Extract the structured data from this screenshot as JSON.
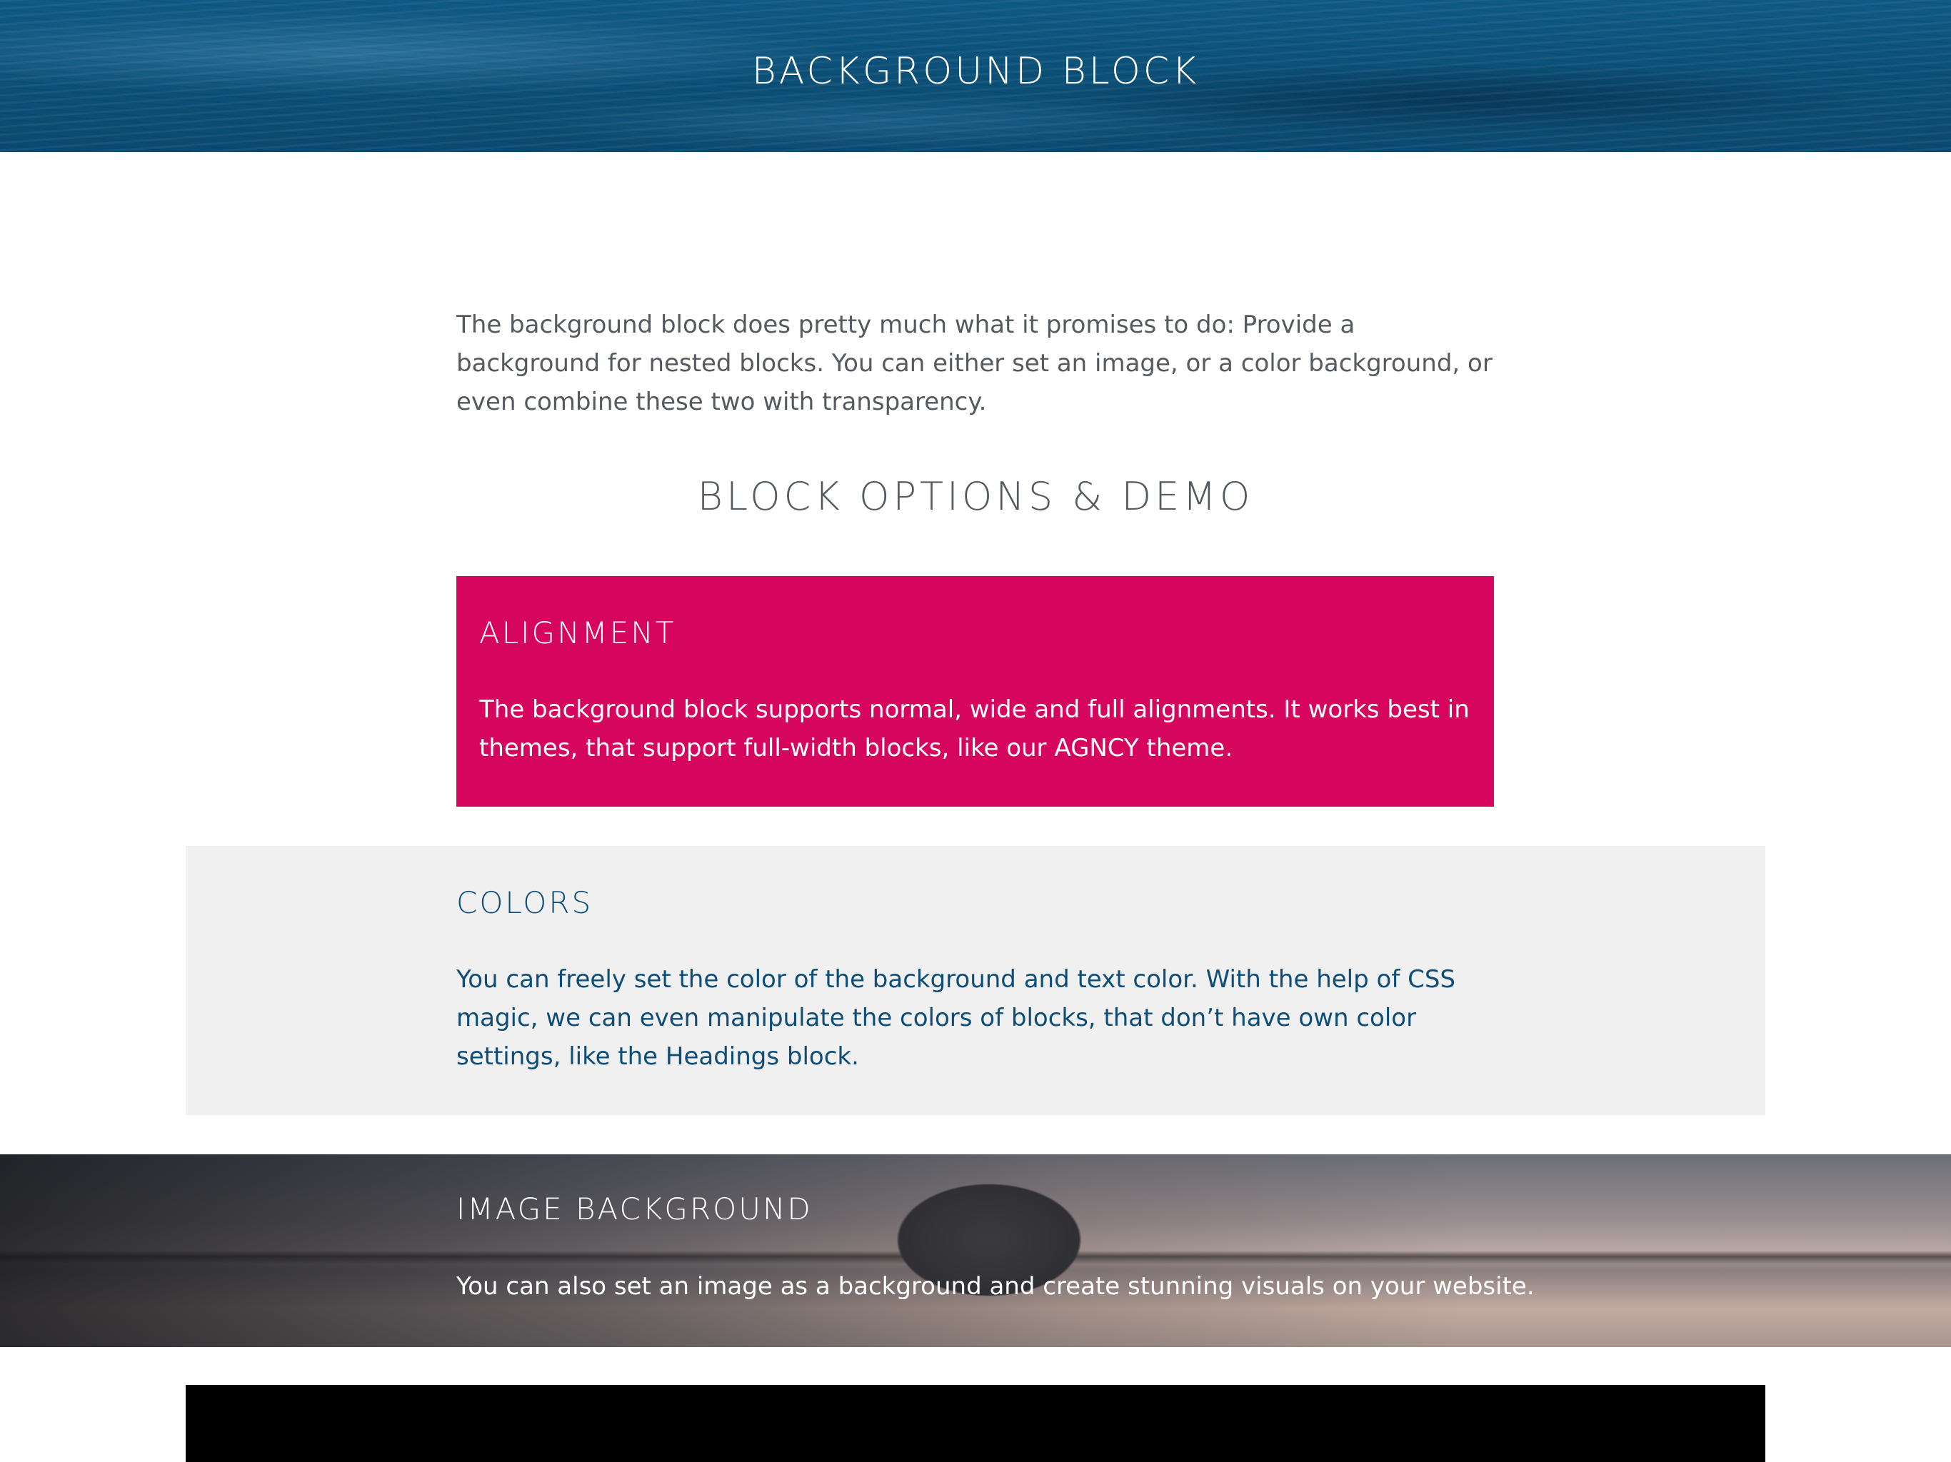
{
  "hero": {
    "title": "BACKGROUND BLOCK"
  },
  "intro": {
    "text": "The background block does pretty much what it promises to do: Provide a background for nested blocks. You can either set an image, or a color background, or even combine these two with transparency."
  },
  "section": {
    "title": "BLOCK OPTIONS & DEMO"
  },
  "alignment": {
    "heading": "ALIGNMENT",
    "text": "The background block supports normal, wide and full alignments. It works best in themes, that support full-width blocks, like our AGNCY theme.",
    "background_color": "#d6065f",
    "text_color": "#ffffff"
  },
  "colors": {
    "heading": "COLORS",
    "text": "You can freely set the color of the background and text color. With the help of CSS magic, we can even manipulate the colors of blocks, that don’t have own color settings, like the Headings block.",
    "background_color": "#f0f0f0",
    "text_color": "#0d4d77"
  },
  "image_background": {
    "heading": "IMAGE BACKGROUND",
    "text": "You can also set an image as a background and create stunning visuals on your website.",
    "text_color": "#ffffff"
  },
  "theme": {
    "header_blue": "#0c5078",
    "body_text": "#555a5f",
    "black_block": "#000000"
  }
}
